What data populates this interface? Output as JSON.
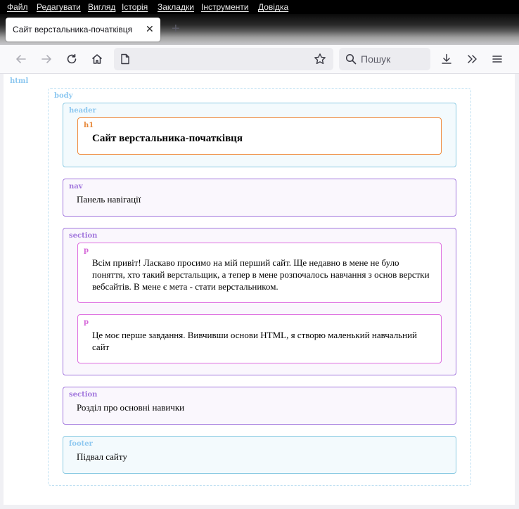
{
  "menu": [
    "Файл",
    "Редагувати",
    "Вигляд",
    "Історія",
    "Закладки",
    "Інструменти",
    "Довідка"
  ],
  "tab": {
    "title": "Сайт верстальника-початківця",
    "close_icon": "close-icon"
  },
  "toolbar": {
    "search_placeholder": "Пошук"
  },
  "page": {
    "labels": {
      "html": "html",
      "body": "body",
      "header": "header",
      "h1": "h1",
      "nav": "nav",
      "section": "section",
      "p": "p",
      "footer": "footer"
    },
    "h1": "Сайт верстальника-початківця",
    "nav": "Панель навігації",
    "p1": "Всім привіт! Ласкаво просимо на мій перший сайт. Ще недавно в мене не було поняття, хто такий верстальщик, а тепер в мене розпочалось навчання з основ верстки вебсайтів. В мене є мета - стати верстальником.",
    "p2": "Це моє перше завдання. Вивчивши основи HTML, я створю маленький навчальний сайт",
    "section2": "Розділ про основні навички",
    "footer": "Підвал сайту"
  },
  "colors": {
    "html_label": "#8ec8f0",
    "body_border": "#bfe0f2",
    "header_border": "#8ccbe3",
    "header_bg": "#f3fafd",
    "h1_border": "#f08a3c",
    "h1_label": "#e8893a",
    "nav_border": "#a277dd",
    "nav_bg": "#faf7fd",
    "p_border": "#de6fe0",
    "p_label": "#d566d8",
    "footer_border": "#8ccbe3",
    "footer_bg": "#f3fafd"
  }
}
